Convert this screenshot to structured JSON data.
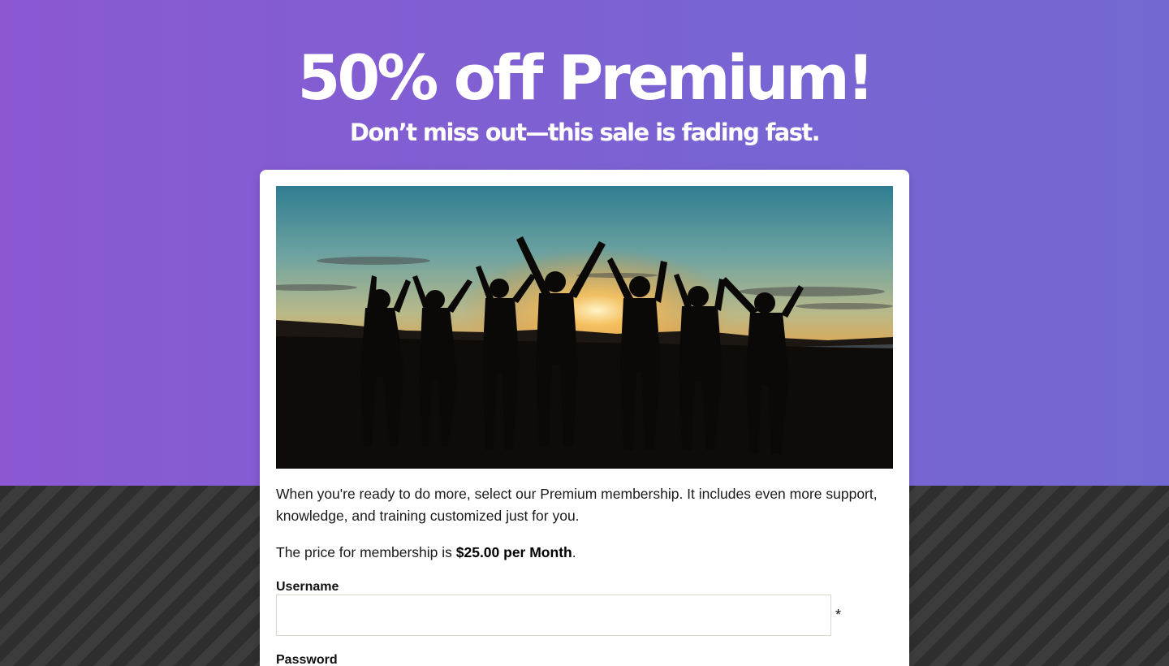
{
  "hero": {
    "headline": "50% off Premium!",
    "subheadline": "Don’t miss out—this sale is fading fast.",
    "gradient_start": "#8b58d2",
    "gradient_end": "#7368d1"
  },
  "card": {
    "image": "group of people silhouetted raising hands at sunset",
    "description": "When you're ready to do more, select our Premium membership. It includes even more support, knowledge, and training customized just for you.",
    "price_prefix": "The price for membership is ",
    "price_value": "$25.00 per Month",
    "price_suffix": "."
  },
  "form": {
    "username_label": "Username",
    "username_value": "",
    "username_required": "*",
    "password_label": "Password"
  }
}
